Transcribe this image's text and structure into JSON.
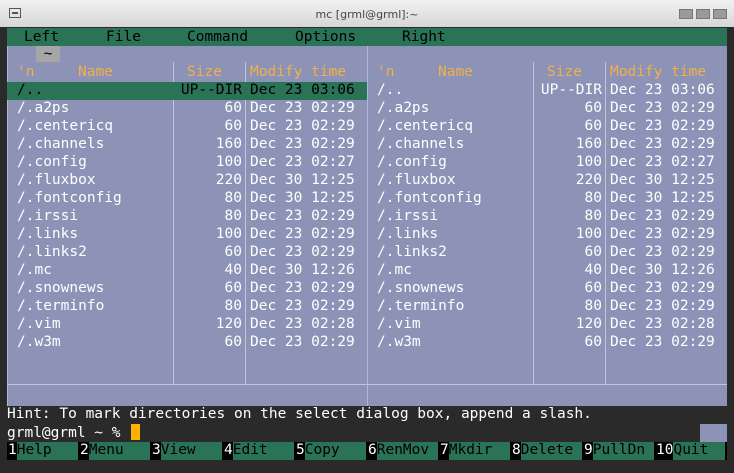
{
  "window": {
    "title": "mc [grml@grml]:~"
  },
  "menubar": {
    "items": [
      "Left",
      "File",
      "Command",
      "Options",
      "Right"
    ]
  },
  "tilde": "~",
  "panels": {
    "headers": {
      "n": "'n",
      "name": "Name",
      "size": "Size",
      "modify": "Modify time"
    },
    "left": {
      "rows": [
        {
          "name": "/..",
          "size": "UP--DIR",
          "time": "Dec 23 03:06"
        },
        {
          "name": "/.a2ps",
          "size": "60",
          "time": "Dec 23 02:29"
        },
        {
          "name": "/.centericq",
          "size": "60",
          "time": "Dec 23 02:29"
        },
        {
          "name": "/.channels",
          "size": "160",
          "time": "Dec 23 02:29"
        },
        {
          "name": "/.config",
          "size": "100",
          "time": "Dec 23 02:27"
        },
        {
          "name": "/.fluxbox",
          "size": "220",
          "time": "Dec 30 12:25"
        },
        {
          "name": "/.fontconfig",
          "size": "80",
          "time": "Dec 30 12:25"
        },
        {
          "name": "/.irssi",
          "size": "80",
          "time": "Dec 23 02:29"
        },
        {
          "name": "/.links",
          "size": "100",
          "time": "Dec 23 02:29"
        },
        {
          "name": "/.links2",
          "size": "60",
          "time": "Dec 23 02:29"
        },
        {
          "name": "/.mc",
          "size": "40",
          "time": "Dec 30 12:26"
        },
        {
          "name": "/.snownews",
          "size": "60",
          "time": "Dec 23 02:29"
        },
        {
          "name": "/.terminfo",
          "size": "80",
          "time": "Dec 23 02:29"
        },
        {
          "name": "/.vim",
          "size": "120",
          "time": "Dec 23 02:28"
        },
        {
          "name": "/.w3m",
          "size": "60",
          "time": "Dec 23 02:29"
        }
      ]
    },
    "right": {
      "rows": [
        {
          "name": "/..",
          "size": "UP--DIR",
          "time": "Dec 23 03:06"
        },
        {
          "name": "/.a2ps",
          "size": "60",
          "time": "Dec 23 02:29"
        },
        {
          "name": "/.centericq",
          "size": "60",
          "time": "Dec 23 02:29"
        },
        {
          "name": "/.channels",
          "size": "160",
          "time": "Dec 23 02:29"
        },
        {
          "name": "/.config",
          "size": "100",
          "time": "Dec 23 02:27"
        },
        {
          "name": "/.fluxbox",
          "size": "220",
          "time": "Dec 30 12:25"
        },
        {
          "name": "/.fontconfig",
          "size": "80",
          "time": "Dec 30 12:25"
        },
        {
          "name": "/.irssi",
          "size": "80",
          "time": "Dec 23 02:29"
        },
        {
          "name": "/.links",
          "size": "100",
          "time": "Dec 23 02:29"
        },
        {
          "name": "/.links2",
          "size": "60",
          "time": "Dec 23 02:29"
        },
        {
          "name": "/.mc",
          "size": "40",
          "time": "Dec 30 12:26"
        },
        {
          "name": "/.snownews",
          "size": "60",
          "time": "Dec 23 02:29"
        },
        {
          "name": "/.terminfo",
          "size": "80",
          "time": "Dec 23 02:29"
        },
        {
          "name": "/.vim",
          "size": "120",
          "time": "Dec 23 02:28"
        },
        {
          "name": "/.w3m",
          "size": "60",
          "time": "Dec 23 02:29"
        }
      ]
    }
  },
  "hint": "Hint: To mark directories on the select dialog box, append a slash.",
  "prompt": "grml@grml ~ %",
  "fkeys": [
    {
      "num": "1",
      "label": "Help"
    },
    {
      "num": "2",
      "label": "Menu"
    },
    {
      "num": "3",
      "label": "View"
    },
    {
      "num": "4",
      "label": "Edit"
    },
    {
      "num": "5",
      "label": "Copy"
    },
    {
      "num": "6",
      "label": "RenMov"
    },
    {
      "num": "7",
      "label": "Mkdir"
    },
    {
      "num": "8",
      "label": "Delete"
    },
    {
      "num": "9",
      "label": "PullDn"
    },
    {
      "num": "10",
      "label": "Quit"
    }
  ],
  "colors": {
    "panel_bg": "#8c93b6",
    "header_fg": "#f3b04a",
    "selection_bg": "#2b7356",
    "cursor": "#ffb000"
  }
}
